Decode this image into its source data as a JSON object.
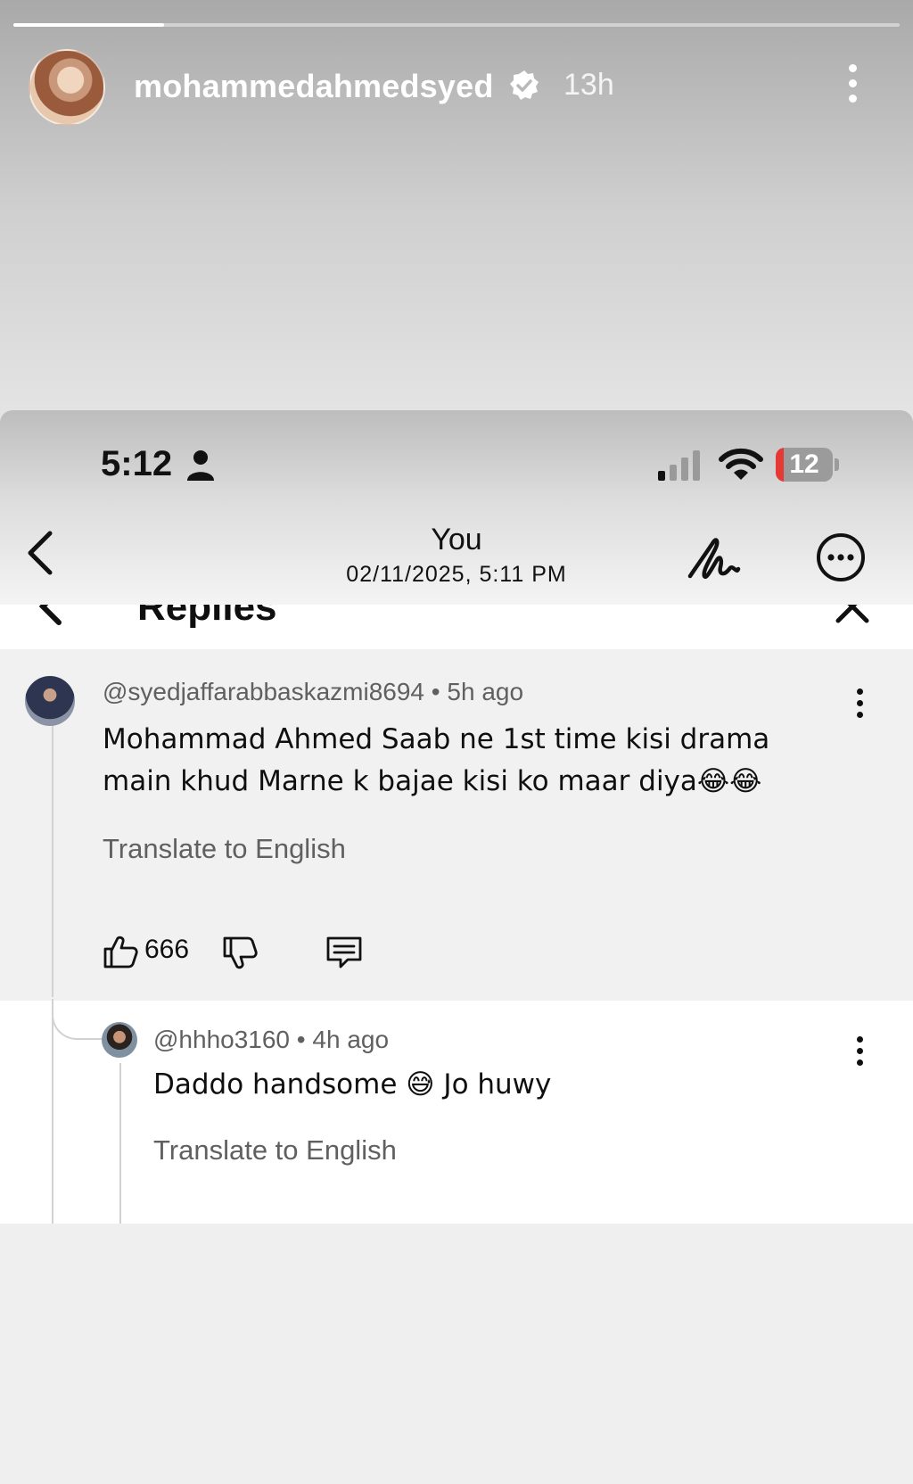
{
  "story": {
    "username": "mohammedahmedsyed",
    "time_ago": "13h",
    "progress": 0.17
  },
  "screenshot": {
    "status_bar": {
      "time": "5:12",
      "battery": "12",
      "battery_level": 0.12
    },
    "nav": {
      "title": "You",
      "date": "02/11/2025, 5:11 PM"
    },
    "replies_header": "Replies",
    "comment": {
      "author": "@syedjaffarabbaskazmi8694",
      "time_ago": "5h ago",
      "text": "Mohammad Ahmed Saab ne 1st time kisi drama main khud Marne k bajae kisi ko maar diya😂😂",
      "translate": "Translate to English",
      "likes": "666"
    },
    "reply": {
      "author": "@hhho3160",
      "time_ago": "4h ago",
      "text": "Daddo handsome 😅 Jo huwy",
      "translate": "Translate to English"
    }
  },
  "colors": {
    "accent_red": "#e53935",
    "meta_gray": "#606060"
  }
}
